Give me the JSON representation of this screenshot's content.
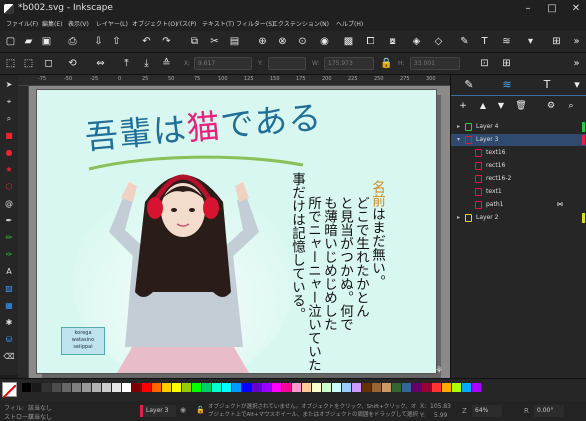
{
  "window": {
    "title": "*b002.svg - Inkscape",
    "min": "–",
    "max": "□",
    "close": "✕"
  },
  "menu": [
    "ファイル(F)",
    "編集(E)",
    "表示(V)",
    "レイヤー(L)",
    "オブジェクト(O)",
    "パス(P)",
    "テキスト(T)",
    "フィルター(S)",
    "エクステンション(N)",
    "ヘルプ(H)"
  ],
  "toolbar": {
    "icons": [
      "new-icon",
      "open-icon",
      "save-icon",
      "print-icon",
      "import-icon",
      "export-icon",
      "undo-icon",
      "redo-icon",
      "copy-icon",
      "cut-icon",
      "paste-icon",
      "zoom-selection-icon",
      "zoom-drawing-icon",
      "zoom-page-icon",
      "duplicate-icon",
      "clone-icon",
      "unlink-icon",
      "group-icon",
      "ungroup-icon",
      "fill-stroke-icon",
      "text-icon",
      "layers-icon",
      "align-icon"
    ]
  },
  "controls": {
    "x_label": "X:",
    "x_value": "9.617",
    "y_label": "Y:",
    "y_value": "",
    "w_label": "W:",
    "w_value": "175.973",
    "h_label": "H:",
    "h_value": "33.001"
  },
  "ruler_top": [
    "-75",
    "-50",
    "-25",
    "0",
    "25",
    "50",
    "75",
    "100",
    "125",
    "150",
    "175",
    "200",
    "225",
    "250",
    "275",
    "300"
  ],
  "document": {
    "title_prefix": "吾輩は",
    "title_highlight": "猫",
    "title_suffix": "である",
    "columns": [
      "名前はまだ無い。",
      "どこで生れたかとん",
      "と見当がつかぬ。何で",
      "も薄暗いじめじめした",
      "所でニャーニャー泣いていた",
      "事だけは記憶している。"
    ],
    "name_word": "名前",
    "badge": [
      "korega",
      "watasino",
      "seiippai"
    ]
  },
  "layers": [
    {
      "name": "Layer 4",
      "indent": 0,
      "expanded": false,
      "color": "#22cc44",
      "selected": false
    },
    {
      "name": "Layer 3",
      "indent": 0,
      "expanded": true,
      "color": "#e0224a",
      "selected": true
    },
    {
      "name": "text16",
      "indent": 1,
      "icon": "text",
      "color": "",
      "selected": false
    },
    {
      "name": "rect16",
      "indent": 1,
      "icon": "rect",
      "color": "",
      "selected": false
    },
    {
      "name": "rect16-2",
      "indent": 1,
      "icon": "rect",
      "color": "",
      "selected": false
    },
    {
      "name": "text1",
      "indent": 1,
      "icon": "text",
      "color": "",
      "selected": false
    },
    {
      "name": "path1",
      "indent": 1,
      "icon": "path",
      "color": "",
      "selected": false
    },
    {
      "name": "Layer 2",
      "indent": 0,
      "expanded": false,
      "color": "#dddd22",
      "selected": false
    }
  ],
  "palette": [
    "#000000",
    "#1a1a1a",
    "#333333",
    "#4d4d4d",
    "#666666",
    "#808080",
    "#999999",
    "#b3b3b3",
    "#cccccc",
    "#e6e6e6",
    "#ffffff",
    "#800000",
    "#ff0000",
    "#ff6600",
    "#ffcc00",
    "#ffff00",
    "#99cc00",
    "#00ff00",
    "#00cc66",
    "#00ffcc",
    "#00ffff",
    "#0099ff",
    "#0000ff",
    "#6600cc",
    "#9900ff",
    "#ff00ff",
    "#ff0099",
    "#ff99cc",
    "#ffcc99",
    "#ffffcc",
    "#ccffcc",
    "#ccffff",
    "#99ccff",
    "#cc99ff",
    "#663300",
    "#996633",
    "#cc9966",
    "#336633",
    "#336699",
    "#660066",
    "#990033",
    "#ff3333",
    "#ffaa00",
    "#aaff00",
    "#00aaff",
    "#aa00ff"
  ],
  "status": {
    "fill_label": "フィル:",
    "fill_value": "該当なし",
    "stroke_label": "ストローク:",
    "stroke_value": "該当なし",
    "layer": "Layer 3",
    "message": "オブジェクトが選択されていません。オブジェクトをクリック、Shift+クリック、オブジェクト上でAlt+マウスホイール、またはオブジェクトの周囲をドラッグして選択します。",
    "x_label": "X:",
    "x_value": "105.83",
    "y_label": "Y:",
    "y_value": "5.99",
    "zoom": "64%",
    "rotation": "0.00°"
  }
}
